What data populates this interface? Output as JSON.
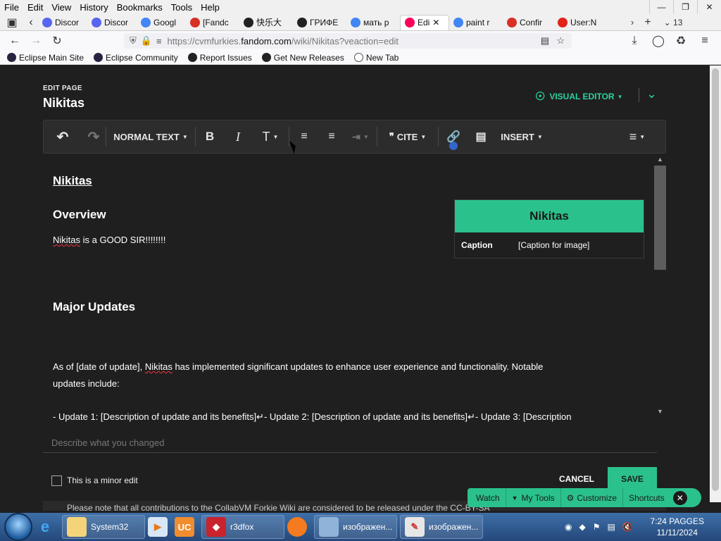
{
  "menubar": {
    "items": [
      "File",
      "Edit",
      "View",
      "History",
      "Bookmarks",
      "Tools",
      "Help"
    ]
  },
  "tabs": [
    {
      "label": "Discor",
      "icon": "discord-icon",
      "color": "#5865f2"
    },
    {
      "label": "Discor",
      "icon": "discord-icon",
      "color": "#5865f2"
    },
    {
      "label": "Googl",
      "icon": "google-icon",
      "color": "#4285f4"
    },
    {
      "label": "[Fandc",
      "icon": "gmail-icon",
      "color": "#d93025"
    },
    {
      "label": "快乐大",
      "icon": "mask-icon",
      "color": "#222222"
    },
    {
      "label": "ГРИФЕ",
      "icon": "youtube-icon",
      "color": "#222222"
    },
    {
      "label": "мать р",
      "icon": "google-icon",
      "color": "#4285f4"
    },
    {
      "label": "Edi",
      "icon": "fandom-icon",
      "color": "#fa005a",
      "active": true
    },
    {
      "label": "paint r",
      "icon": "google-icon",
      "color": "#4285f4"
    },
    {
      "label": "Confir",
      "icon": "gmail-icon",
      "color": "#d93025"
    },
    {
      "label": "User:N",
      "icon": "fandom-icon",
      "color": "#e2231a"
    }
  ],
  "tab_count": "13",
  "url": {
    "prefix": "https://cvmfurkies.",
    "domain": "fandom.com",
    "path": "/wiki/Nikitas?veaction=edit"
  },
  "bookmarks": [
    {
      "label": "Eclipse Main Site",
      "color": "#2a2340"
    },
    {
      "label": "Eclipse Community",
      "color": "#2a2340"
    },
    {
      "label": "Report Issues",
      "color": "#222222"
    },
    {
      "label": "Get New Releases",
      "color": "#222222"
    },
    {
      "label": "New Tab",
      "color": "#555555"
    }
  ],
  "editor": {
    "edit_label": "EDIT PAGE",
    "page_title": "Nikitas",
    "visual_editor_label": "VISUAL EDITOR",
    "toolbar": {
      "paragraph_style": "NORMAL TEXT",
      "cite": "CITE",
      "insert": "INSERT"
    },
    "content": {
      "heading": "Nikitas",
      "overview_heading": "Overview",
      "overview_name": "Nikitas",
      "overview_rest": " is a GOOD SIR!!!!!!!!",
      "updates_heading": "Major Updates",
      "para_start": "As of [date of update], ",
      "para_name": "Nikitas",
      "para_rest": " has implemented significant updates to enhance user experience and functionality. Notable",
      "para_line2": "updates include:",
      "update_line": "- Update 1: [Description of update and its benefits]↵- Update 2: [Description of update and its benefits]↵- Update 3: [Description"
    },
    "infobox": {
      "title": "Nikitas",
      "caption_label": "Caption",
      "caption_value": "[Caption for image]"
    },
    "summary_placeholder": "Describe what you changed",
    "minor_edit_label": "This is a minor edit",
    "cancel_label": "CANCEL",
    "save_label": "SAVE",
    "footer_note": "Please note that all contributions to the CollabVM Forkie Wiki are considered to be released under the CC-BY-SA"
  },
  "tools_bar": {
    "watch": "Watch",
    "my_tools": "My Tools",
    "customize": "Customize",
    "shortcuts": "Shortcuts"
  },
  "taskbar": {
    "items": [
      {
        "label": "System32"
      },
      {
        "label": "r3dfox"
      },
      {
        "label": "изображен..."
      },
      {
        "label": "изображен..."
      }
    ],
    "clock_time": "7:24 PAGGES",
    "clock_date": "11/11/2024"
  },
  "colors": {
    "accent": "#2bc18d",
    "accent_text": "#2bd2a0",
    "editor_bg": "#1f1f1f",
    "toolbar_bg": "#2c2c2c"
  }
}
